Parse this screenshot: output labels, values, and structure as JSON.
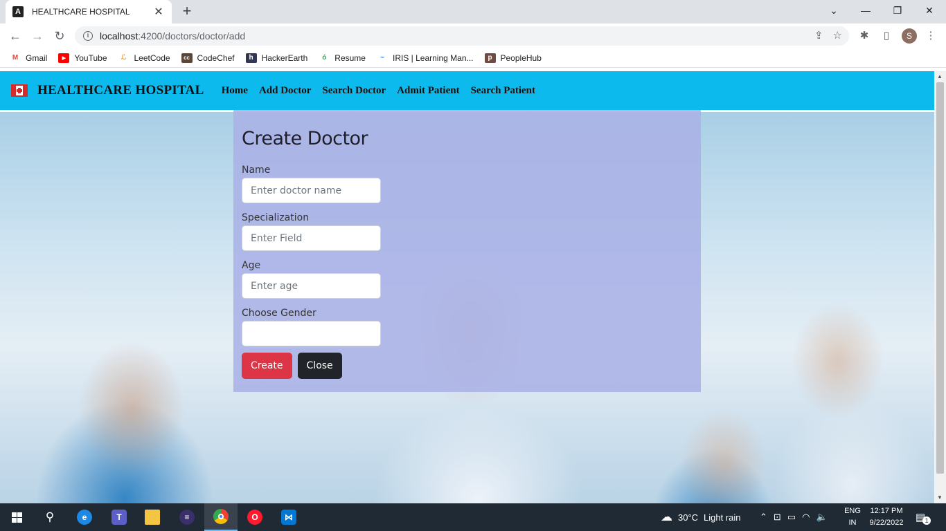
{
  "browser": {
    "tab_title": "HEALTHCARE HOSPITAL",
    "url_host": "localhost",
    "url_path": ":4200/doctors/doctor/add",
    "profile_initial": "S",
    "bookmarks": [
      {
        "label": "Gmail",
        "icon": "gmail-icon",
        "color": "#ea4335",
        "glyph": "M"
      },
      {
        "label": "YouTube",
        "icon": "youtube-icon",
        "color": "#ff0000",
        "glyph": "▶"
      },
      {
        "label": "LeetCode",
        "icon": "leetcode-icon",
        "color": "#f89f1b",
        "glyph": "L"
      },
      {
        "label": "CodeChef",
        "icon": "codechef-icon",
        "color": "#5b4638",
        "glyph": "cc"
      },
      {
        "label": "HackerEarth",
        "icon": "hackerearth-icon",
        "color": "#323754",
        "glyph": "h"
      },
      {
        "label": "Resume",
        "icon": "resume-icon",
        "color": "#34a853",
        "glyph": "ó"
      },
      {
        "label": "IRIS | Learning Man...",
        "icon": "iris-icon",
        "color": "#1976d2",
        "glyph": "~"
      },
      {
        "label": "PeopleHub",
        "icon": "peoplehub-icon",
        "color": "#6d4c41",
        "glyph": "p"
      }
    ]
  },
  "app": {
    "brand": "HEALTHCARE HOSPITAL",
    "nav": [
      "Home",
      "Add Doctor",
      "Search Doctor",
      "Admit Patient",
      "Search Patient"
    ],
    "colors": {
      "navbar": "#0dbaed",
      "create": "#dc3545",
      "close": "#212529"
    }
  },
  "form": {
    "title": "Create Doctor",
    "name_label": "Name",
    "name_placeholder": "Enter doctor name",
    "spec_label": "Specialization",
    "spec_placeholder": "Enter Field",
    "age_label": "Age",
    "age_placeholder": "Enter age",
    "gender_label": "Choose Gender",
    "gender_value": "",
    "create_label": "Create",
    "close_label": "Close"
  },
  "taskbar": {
    "weather": "30°C",
    "weather_desc": "Light rain",
    "lang_line1": "ENG",
    "lang_line2": "IN",
    "time": "12:17 PM",
    "date": "9/22/2022",
    "notifications": "1"
  }
}
